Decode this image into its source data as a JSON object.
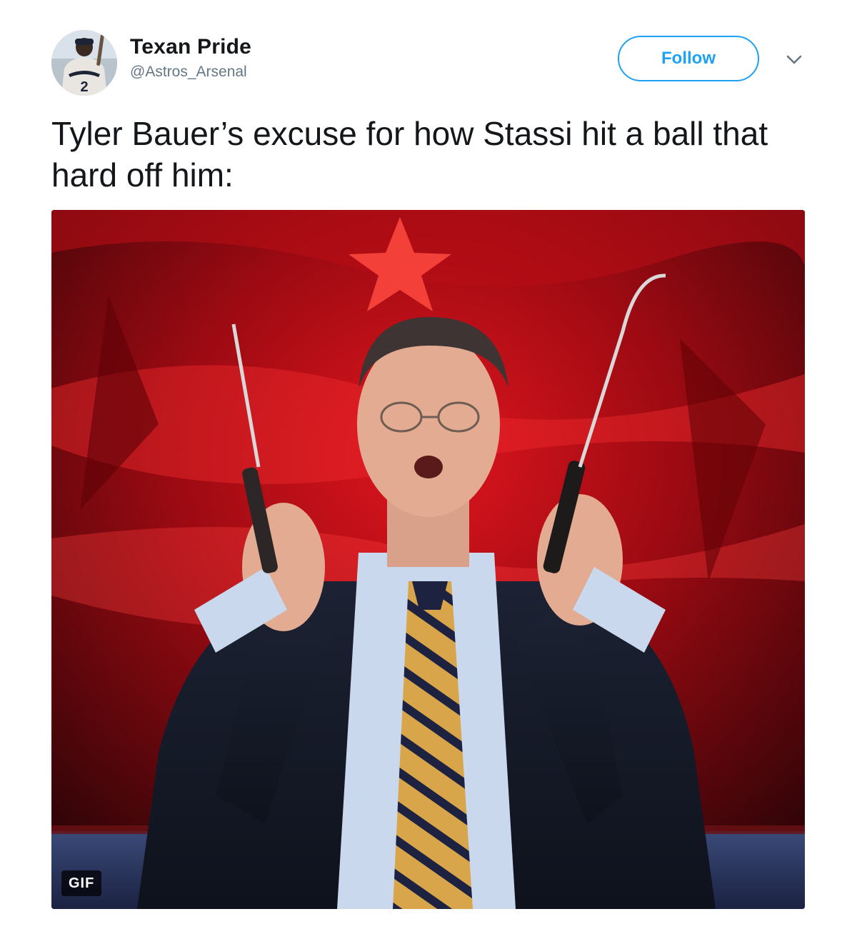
{
  "author": {
    "display_name": "Texan Pride",
    "handle": "@Astros_Arsenal",
    "avatar_icon": "baseball-player-avatar"
  },
  "actions": {
    "follow_label": "Follow",
    "more_icon": "chevron-down-icon"
  },
  "tweet": {
    "text": "Tyler Bauer’s excuse for how Stassi hit a ball that hard off him:"
  },
  "media": {
    "type": "gif",
    "badge": "GIF"
  },
  "colors": {
    "accent": "#1da1f2",
    "text": "#14171a",
    "secondary_text": "#657786"
  }
}
